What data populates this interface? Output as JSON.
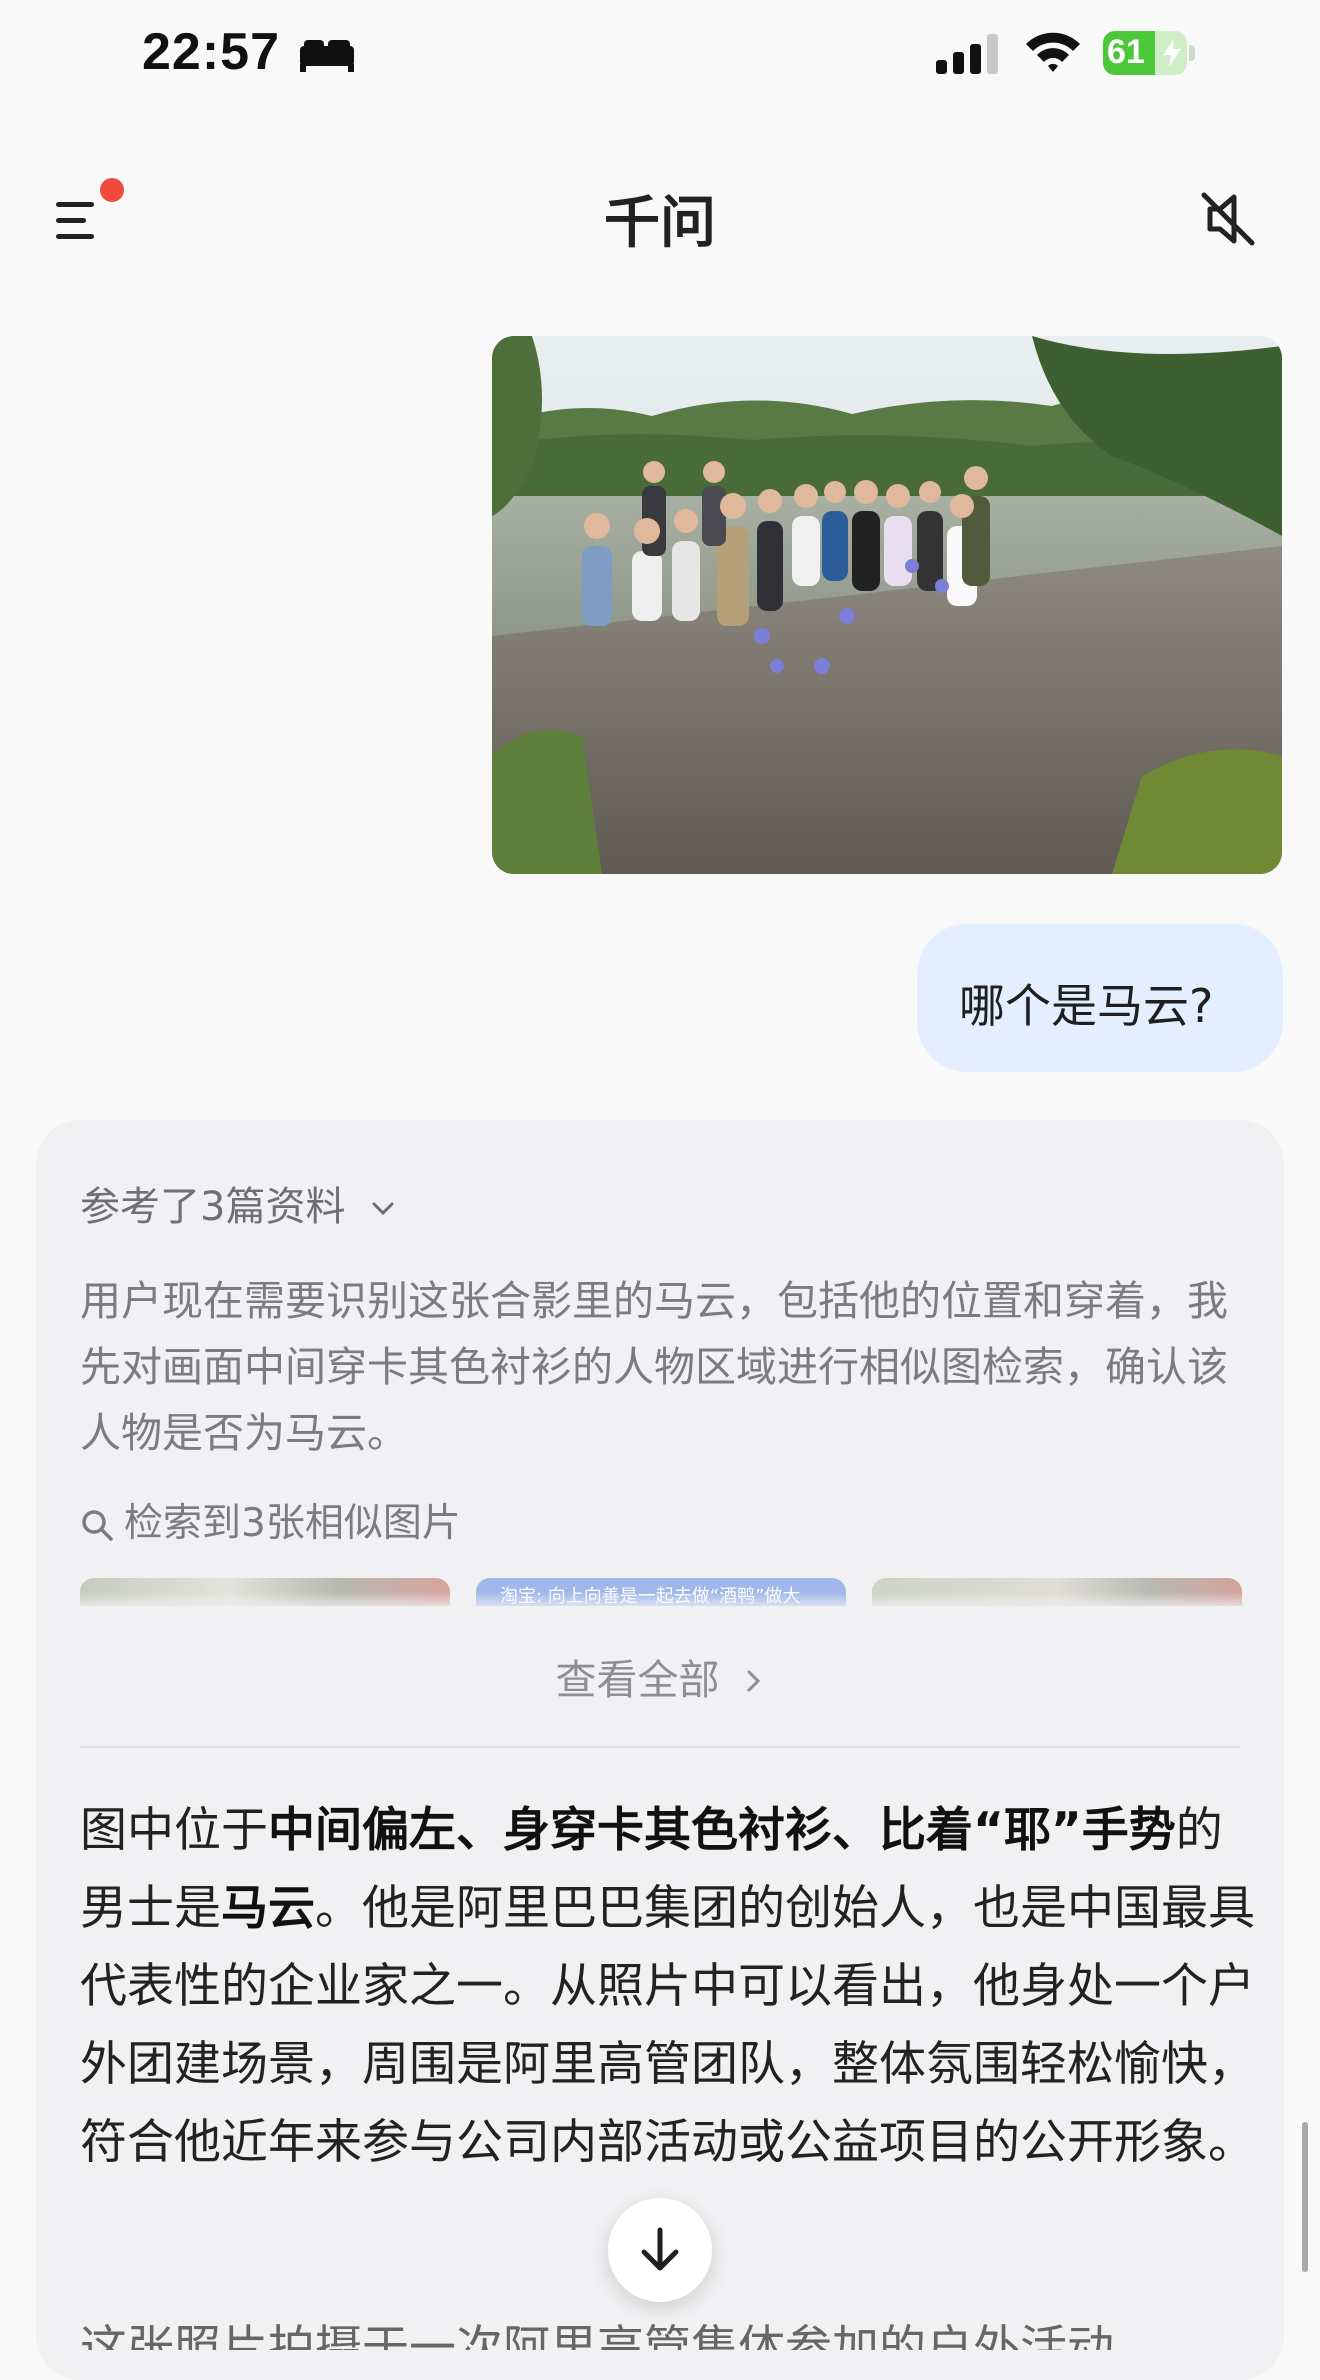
{
  "status_bar": {
    "time": "22:57",
    "battery": "61",
    "battery_color": "#4cc73a"
  },
  "nav": {
    "title": "千问",
    "menu_icon": "menu-icon",
    "mute_icon": "speaker-muted-icon",
    "notification_dot_color": "#f04a3e"
  },
  "user_message": {
    "text": "哪个是马云?"
  },
  "assistant": {
    "references_label": "参考了3篇资料",
    "thinking_text": "用户现在需要识别这张合影里的马云，包括他的位置和穿着，我先对画面中间穿卡其色衬衫的人物区域进行相似图检索，确认该人物是否为马云。",
    "search_result_label": "检索到3张相似图片",
    "thumbnail_caption": "淘宝: 向上向善是一起去做“酒鸭”做大",
    "view_all_label": "查看全部",
    "answer": {
      "p1": "图中位于",
      "b1": "中间偏左、身穿卡其色衬衫、比着“耶”手势",
      "p2": "的男士是",
      "b2": "马云",
      "p3": "。他是阿里巴巴集团的创始人，也是中国最具代表性的企业家之一。从照片中可以看出，他身处一个户外团建场景，周围是阿里高管团队，整体氛围轻松愉快，符合他近年来参与公司内部活动或公益项目的公开形象。"
    },
    "answer_next_line": "这张照片拍摄于一次阿里高管集体参加的户外活动"
  },
  "colors": {
    "user_bubble": "#e3efff",
    "card_background": "#f1f1f3"
  }
}
